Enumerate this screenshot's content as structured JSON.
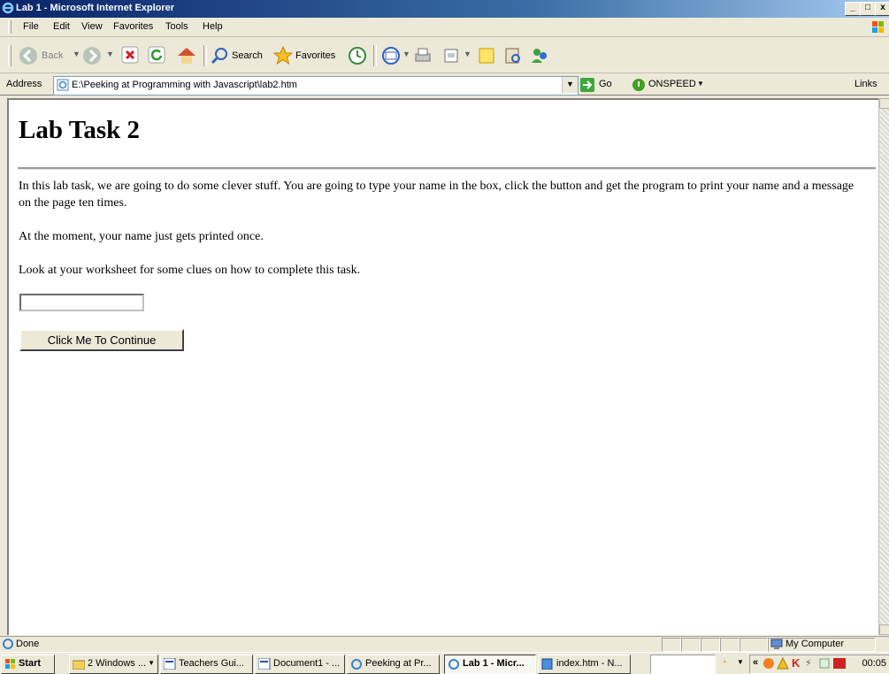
{
  "window": {
    "title": "Lab 1 - Microsoft Internet Explorer",
    "controls": [
      "_",
      "□",
      "x"
    ]
  },
  "menu": [
    "File",
    "Edit",
    "View",
    "Favorites",
    "Tools",
    "Help"
  ],
  "toolbar": {
    "back": "Back",
    "search": "Search",
    "favorites": "Favorites"
  },
  "address_bar": {
    "label": "Address",
    "url": "E:\\Peeking at Programming with Javascript\\lab2.htm",
    "go": "Go",
    "addon": "ONSPEED",
    "links": "Links"
  },
  "page": {
    "heading": "Lab Task 2",
    "paragraphs": [
      "In this lab task, we are going to do some clever stuff. You are going to type your name in the box, click the button and get the program to print your name and a message on the page ten times.",
      "At the moment, your name just gets printed once.",
      "Look at your worksheet for some clues on how to complete this task."
    ],
    "name_input_value": "",
    "button_label": "Click Me To Continue"
  },
  "status_bar": {
    "text": "Done",
    "zone": "My Computer"
  },
  "taskbar": {
    "start": "Start",
    "tasks": [
      {
        "label": "2 Windows ...",
        "active": false
      },
      {
        "label": "Teachers Gui...",
        "active": false
      },
      {
        "label": "Document1 - ...",
        "active": false
      },
      {
        "label": "Peeking at Pr...",
        "active": false
      },
      {
        "label": "Lab 1 - Micr...",
        "active": true
      },
      {
        "label": "index.htm - N...",
        "active": false
      }
    ],
    "clock": "00:05"
  },
  "colors": {
    "titlebar_start": "#0a246a",
    "titlebar_end": "#a6caf0",
    "chrome": "#ece9d8"
  }
}
